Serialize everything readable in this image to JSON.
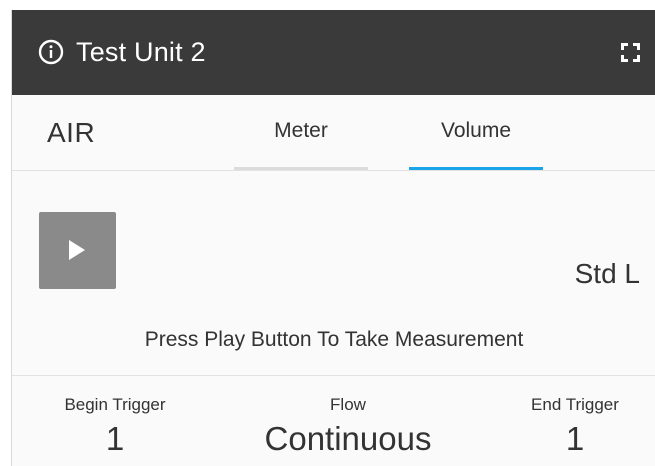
{
  "header": {
    "title": "Test Unit 2",
    "info_icon": "info-circle-icon",
    "expand_icon": "fullscreen-expand-icon",
    "background": "#3a3a3a"
  },
  "mode": {
    "label": "AIR"
  },
  "tabs": [
    {
      "label": "Meter",
      "active": false
    },
    {
      "label": "Volume",
      "active": true
    }
  ],
  "accent_color": "#1aa3e8",
  "measurement": {
    "play_icon": "play-icon",
    "unit": "Std L",
    "hint": "Press Play Button To Take Measurement"
  },
  "stats": {
    "begin_trigger": {
      "label": "Begin Trigger",
      "value": "1"
    },
    "flow": {
      "label": "Flow",
      "value": "Continuous"
    },
    "end_trigger": {
      "label": "End Trigger",
      "value": "1"
    }
  }
}
